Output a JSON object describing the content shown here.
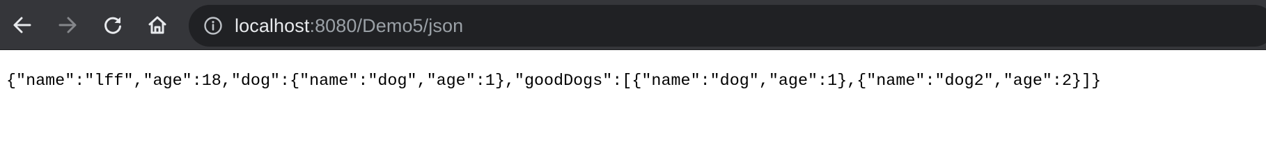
{
  "browser": {
    "toolbar_color": "#35363a",
    "omnibox_color": "#202124",
    "nav": {
      "back_icon": "arrow-left-icon",
      "forward_icon": "arrow-right-icon",
      "reload_icon": "reload-icon",
      "home_icon": "home-icon",
      "forward_enabled": false
    },
    "address_bar": {
      "site_info_icon": "info-icon",
      "host": "localhost",
      "rest": ":8080/Demo5/json"
    }
  },
  "page": {
    "body_text": "{\"name\":\"lff\",\"age\":18,\"dog\":{\"name\":\"dog\",\"age\":1},\"goodDogs\":[{\"name\":\"dog\",\"age\":1},{\"name\":\"dog2\",\"age\":2}]}"
  }
}
